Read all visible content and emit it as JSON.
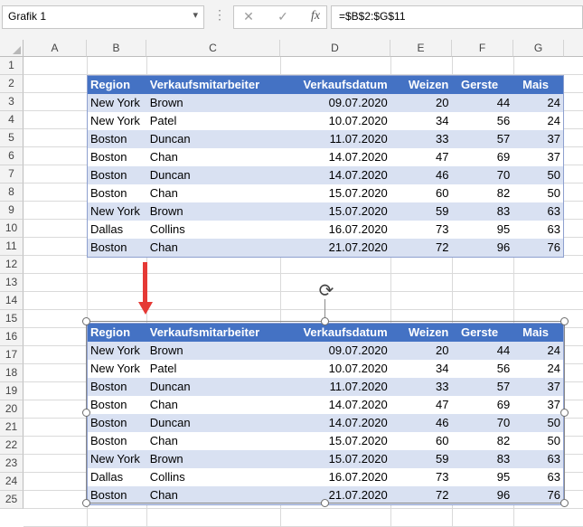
{
  "name_box": {
    "value": "Grafik 1",
    "dropdown_icon": "chevron-down-icon"
  },
  "formula_bar": {
    "cancel_icon": "close-icon",
    "enter_icon": "check-icon",
    "function_label": "fx",
    "formula": "=$B$2:$G$11"
  },
  "columns": [
    "A",
    "B",
    "C",
    "D",
    "E",
    "F",
    "G"
  ],
  "rows": [
    "1",
    "2",
    "3",
    "4",
    "5",
    "6",
    "7",
    "8",
    "9",
    "10",
    "11",
    "12",
    "13",
    "14",
    "15",
    "16",
    "17",
    "18",
    "19",
    "20",
    "21",
    "22",
    "23",
    "24",
    "25"
  ],
  "table": {
    "headers": [
      "Region",
      "Verkaufsmitarbeiter",
      "Verkaufsdatum",
      "Weizen",
      "Gerste",
      "Mais"
    ],
    "rows": [
      [
        "New York",
        "Brown",
        "09.07.2020",
        "20",
        "44",
        "24"
      ],
      [
        "New York",
        "Patel",
        "10.07.2020",
        "34",
        "56",
        "24"
      ],
      [
        "Boston",
        "Duncan",
        "11.07.2020",
        "33",
        "57",
        "37"
      ],
      [
        "Boston",
        "Chan",
        "14.07.2020",
        "47",
        "69",
        "37"
      ],
      [
        "Boston",
        "Duncan",
        "14.07.2020",
        "46",
        "70",
        "50"
      ],
      [
        "Boston",
        "Chan",
        "15.07.2020",
        "60",
        "82",
        "50"
      ],
      [
        "New York",
        "Brown",
        "15.07.2020",
        "59",
        "83",
        "63"
      ],
      [
        "Dallas",
        "Collins",
        "16.07.2020",
        "73",
        "95",
        "63"
      ],
      [
        "Boston",
        "Chan",
        "21.07.2020",
        "72",
        "96",
        "76"
      ]
    ]
  },
  "colors": {
    "header": "#4472c4",
    "band": "#d9e1f2",
    "arrow": "#e53935"
  }
}
